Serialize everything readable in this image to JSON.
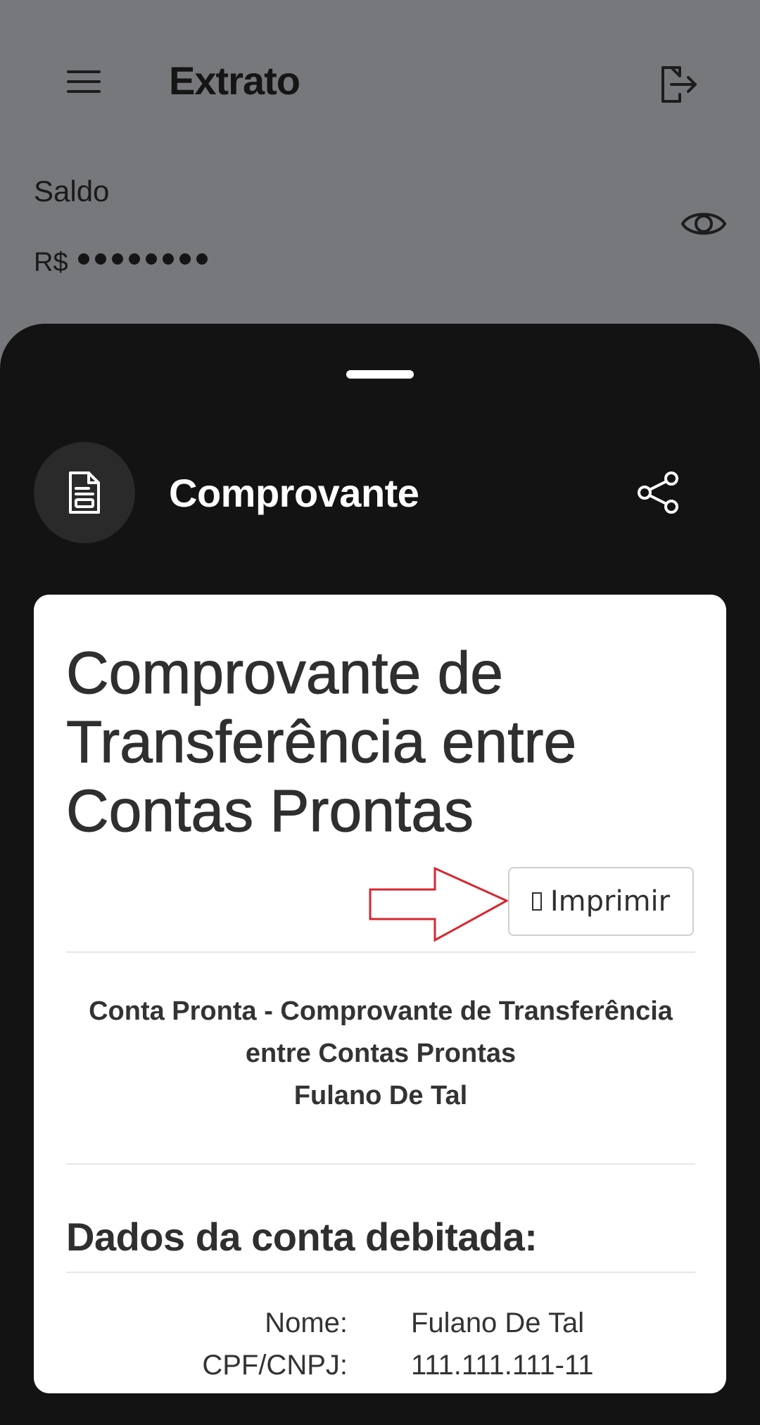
{
  "appbar": {
    "title": "Extrato",
    "menu_icon": "menu-icon",
    "logout_icon": "logout-icon"
  },
  "balance": {
    "label": "Saldo",
    "currency": "R$",
    "masked_value": "••••••••",
    "visibility_icon": "eye-icon"
  },
  "sheet": {
    "title": "Comprovante",
    "doc_icon": "document-icon",
    "share_icon": "share-icon"
  },
  "receipt": {
    "title": "Comprovante de Transferência entre Contas Prontas",
    "print_label": "Imprimir",
    "subtitle_lines": [
      "Conta Pronta - Comprovante de Transferência",
      "entre Contas Prontas",
      "Fulano De Tal"
    ],
    "section_heading": "Dados da conta debitada:",
    "fields": [
      {
        "label": "Nome:",
        "value": "Fulano De Tal"
      },
      {
        "label": "CPF/CNPJ:",
        "value": "111.111.111-11"
      }
    ]
  },
  "colors": {
    "overlay_background": "#77787c",
    "sheet_background": "#131313",
    "card_background": "#ffffff",
    "annotation_arrow": "#d8262f"
  }
}
